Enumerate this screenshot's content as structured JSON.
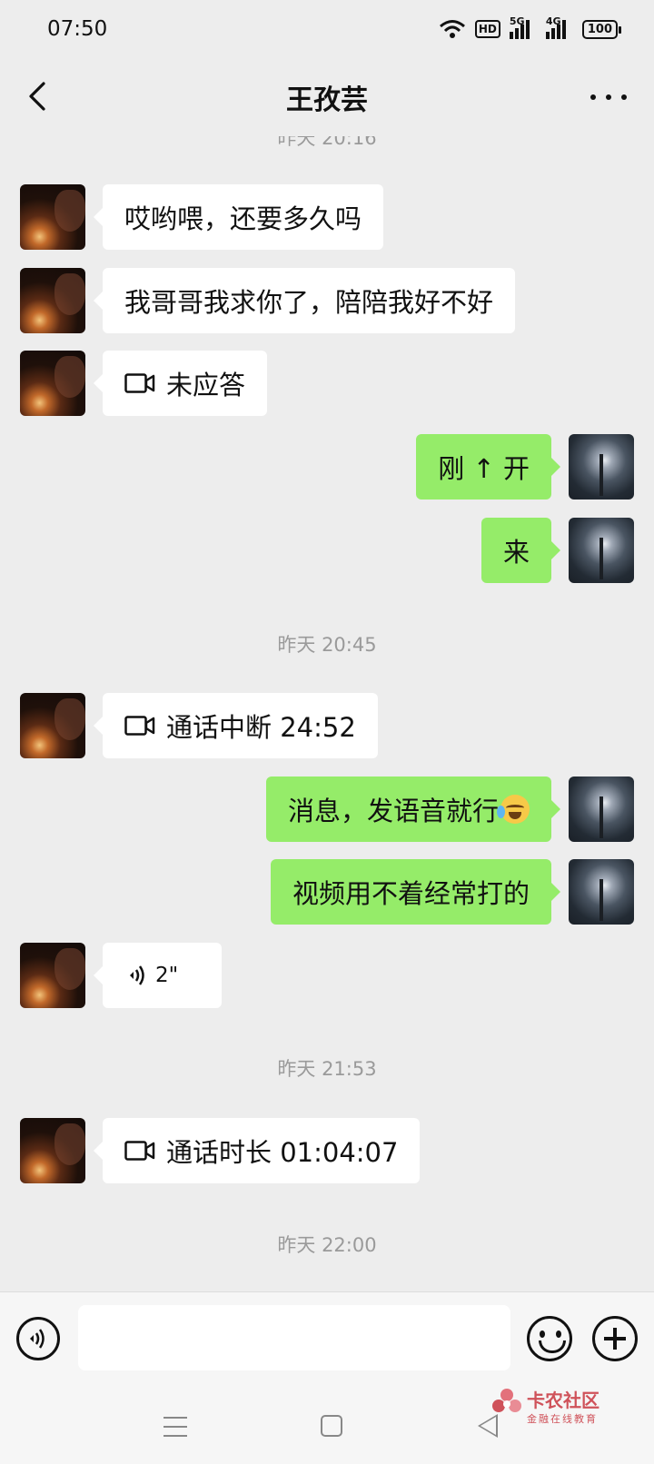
{
  "status_bar": {
    "time": "07:50",
    "wifi_icon": "wifi-icon",
    "hd_label": "HD",
    "signal1_label": "5G",
    "signal2_label": "4G",
    "battery": "100"
  },
  "header": {
    "title": "王孜芸",
    "back_icon": "chevron-left-icon",
    "more_icon": "more-dots-icon"
  },
  "messages": {
    "ts0": "昨天 20:16",
    "m1": "哎哟喂，还要多久吗",
    "m2": "我哥哥我求你了，陪陪我好不好",
    "m3": "未应答",
    "m4": "刚 ↑ 开",
    "m5": "来",
    "ts1": "昨天 20:45",
    "m6": "通话中断 24:52",
    "m7": "消息，发语音就行",
    "m8": "视频用不着经常打的",
    "m9": "2\"",
    "ts2": "昨天 21:53",
    "m10": "通话时长 01:04:07",
    "ts3": "昨天 22:00"
  },
  "input_bar": {
    "value": "",
    "voice_icon": "voice-input-icon",
    "emoji_icon": "emoji-icon",
    "plus_icon": "plus-icon"
  },
  "watermark": {
    "title": "卡农社区",
    "subtitle": "金融在线教育"
  },
  "colors": {
    "background": "#ededed",
    "sent_bubble": "#95ec69",
    "received_bubble": "#ffffff",
    "timestamp": "#9a9a9a"
  }
}
